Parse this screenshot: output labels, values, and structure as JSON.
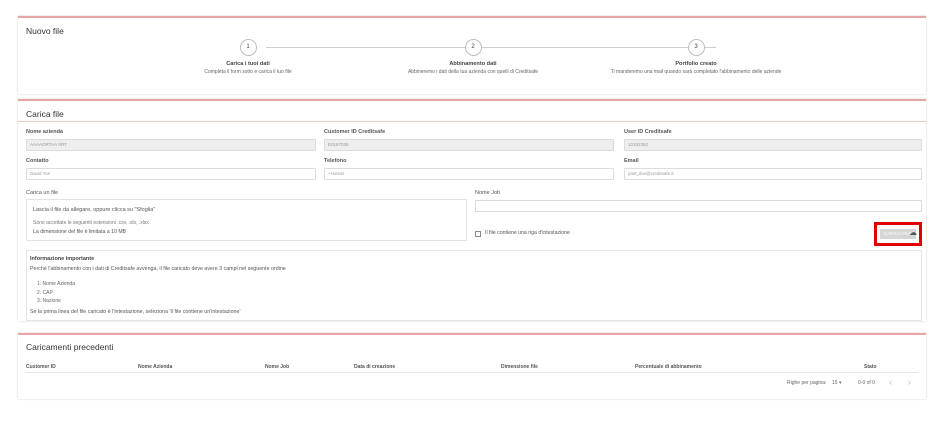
{
  "new_file": {
    "title": "Nuovo file",
    "steps": [
      {
        "number": "1",
        "title": "Carica i tuoi dati",
        "desc": "Completa il form sotto e carica il tuo file"
      },
      {
        "number": "2",
        "title": "Abbinamento dati",
        "desc": "Abbineremo i dati della tua azienda con quelli di Creditsafe"
      },
      {
        "number": "3",
        "title": "Portfolio creato",
        "desc": "Ti manderemo una mail quando sarà completato l'abbinamento delle aziende"
      }
    ]
  },
  "upload": {
    "title": "Carica file",
    "fields": {
      "company_label": "Nome azienda",
      "company_value": "AAAAORTAA SRT",
      "customer_id_label": "Customer ID Creditsafe",
      "customer_id_value": "E0167028",
      "user_id_label": "User ID Creditsafe",
      "user_id_value": "10102352",
      "contact_label": "Contatto",
      "contact_value": "David Yon",
      "phone_label": "Telefono",
      "phone_value": "+Homal",
      "email_label": "Email",
      "email_value": "yant_iloe@creditsafe.it"
    },
    "file_label": "Carica un file",
    "job_label": "Nome Job",
    "dropzone": {
      "main": "Lascia il file da allegare, oppure clicca su \"Sfoglia\"",
      "extensions": "Sono accettate le seguenti estensioni .csv, .xls, .xlsx",
      "size": "La dimensione del file è limitata a 10 MB"
    },
    "header_checkbox_label": "Il file contiene una riga d'intestazione",
    "upload_button_label": "CARICA FILE",
    "upload_icon": "upload-cloud-icon",
    "info": {
      "title": "Informazione importante",
      "desc": "Perché l'abbinamento con i dati di Creditsafe avvenga, il file caricato deve avere 3 campi nel seguente ordine",
      "items": [
        "1. Nome Azienda",
        "2. CAP",
        "3. Nazione"
      ],
      "footer": "Se la prima linea del file caricato è l'intestazione, seleziona 'Il file contiene un'intestazione'"
    }
  },
  "previous": {
    "title": "Caricamenti precedenti",
    "columns": [
      "Customer ID",
      "Nome Azienda",
      "Nome Job",
      "Data di creazione",
      "Dimensione file",
      "Percentuale di abbinamento",
      "Stato"
    ],
    "rows_per_page_label": "Righe per pagina:",
    "rows_per_page_value": "15",
    "range": "0-0 of 0"
  },
  "colors": {
    "accent_border": "#e8a3a3",
    "highlight_red": "#e00000"
  }
}
